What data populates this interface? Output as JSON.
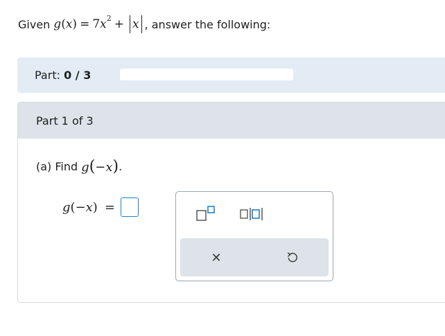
{
  "question": {
    "prefix": "Given",
    "func": "g",
    "arg": "x",
    "coef": "7",
    "var": "x",
    "exponent": "2",
    "plus": "+",
    "abs_var": "x",
    "suffix": ", answer the following:"
  },
  "progress": {
    "label": "Part:",
    "value_text": "0 / 3",
    "fraction": 0.0
  },
  "part": {
    "header": "Part 1 of 3",
    "prompt_prefix": "(a) Find",
    "func": "g",
    "arg": "−x",
    "prompt_end": "."
  },
  "answer": {
    "lhs_func": "g",
    "lhs_arg": "−x",
    "equals": "="
  },
  "palette": {
    "tools": [
      {
        "name": "exponent-tool",
        "icon": "exponent-template-icon"
      },
      {
        "name": "absolute-value-tool",
        "icon": "absolute-value-template-icon"
      }
    ],
    "actions": [
      {
        "name": "clear",
        "icon": "close-icon",
        "glyph": "✕"
      },
      {
        "name": "undo",
        "icon": "undo-icon"
      }
    ]
  },
  "colors": {
    "accent": "#1f80c8",
    "progress_bg": "#e3ecf4",
    "header_bg": "#dde3e8",
    "text": "#1f1f1f"
  }
}
